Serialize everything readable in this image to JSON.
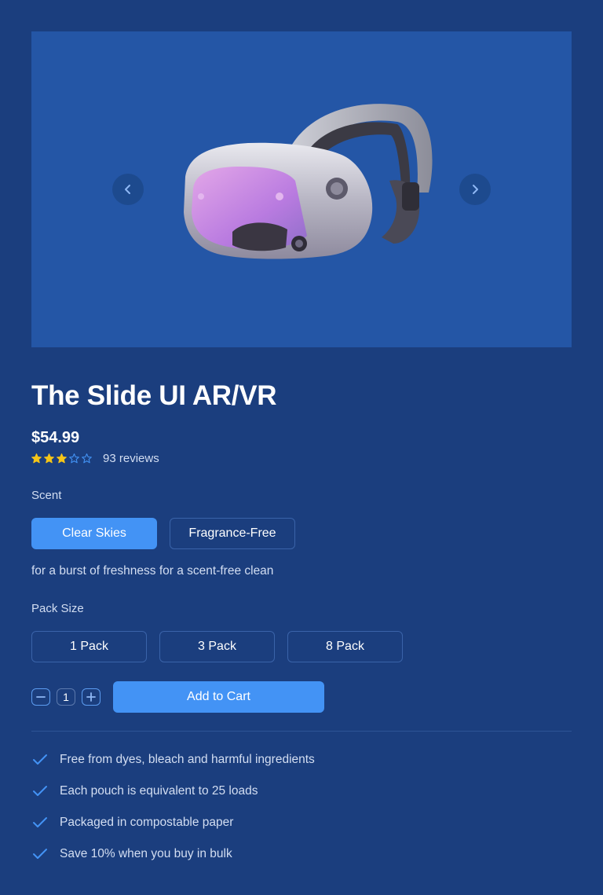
{
  "product": {
    "title": "The Slide UI AR/VR",
    "price": "$54.99",
    "rating": 3,
    "rating_max": 5,
    "reviews": "93 reviews",
    "image_icon": "vr-headset"
  },
  "gallery": {
    "prev_icon": "chevron-left-icon",
    "next_icon": "chevron-right-icon"
  },
  "scent": {
    "label": "Scent",
    "options": [
      "Clear Skies",
      "Fragrance-Free"
    ],
    "selected": "Clear Skies",
    "description": "for a burst of freshness for a scent-free clean"
  },
  "pack": {
    "label": "Pack Size",
    "options": [
      "1 Pack",
      "3 Pack",
      "8 Pack"
    ]
  },
  "cart": {
    "quantity": "1",
    "add_label": "Add to Cart"
  },
  "features": [
    "Free from dyes, bleach and harmful ingredients",
    "Each pouch is equivalent to 25 loads",
    "Packaged in compostable paper",
    "Save 10% when you buy in bulk"
  ],
  "colors": {
    "background": "#1b3e7e",
    "gallery": "#2456a6",
    "accent": "#4393f5",
    "star": "#f5c518"
  }
}
